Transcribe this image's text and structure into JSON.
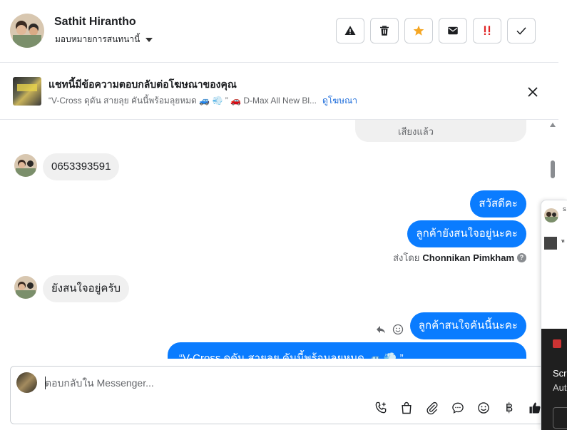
{
  "header": {
    "contact_name": "Sathit Hirantho",
    "assign_label": "มอบหมายการสนทนานี้",
    "actions": [
      {
        "name": "report-button",
        "icon": "warning-icon"
      },
      {
        "name": "delete-button",
        "icon": "trash-icon"
      },
      {
        "name": "star-button",
        "icon": "star-icon"
      },
      {
        "name": "mark-unread-button",
        "icon": "envelope-icon"
      },
      {
        "name": "priority-button",
        "icon": "double-exclamation-icon"
      },
      {
        "name": "mark-done-button",
        "icon": "check-icon"
      }
    ],
    "colors": {
      "star": "#f5a623",
      "priority": "#e02424"
    }
  },
  "ad_banner": {
    "title": "แชทนี้มีข้อความตอบกลับต่อโฆษณาของคุณ",
    "description": "“V-Cross ดุดัน สายลุย คันนี้พร้อมลุยหมด 🚙 💨 ” 🚗 D-Max All New Bl...",
    "link": "ดูโฆษณา"
  },
  "conversation": {
    "top_partial_text": "เสียงแล้ว",
    "messages": [
      {
        "direction": "in",
        "text": "0653393591"
      },
      {
        "direction": "out",
        "text": "สวัสดีคะ"
      },
      {
        "direction": "out",
        "text": "ลูกค้ายังสนใจอยู่นะคะ"
      },
      {
        "direction": "in",
        "text": "ยังสนใจอยู่ครับ"
      },
      {
        "direction": "out",
        "text": "ลูกค้าสนใจคันนี้นะคะ"
      },
      {
        "direction": "out",
        "text": "“V-Cross ดุดัน สายลุย คันนี้พร้อมลุยหมด 🚙 💨 ”"
      }
    ],
    "sent_by_prefix": "ส่งโดย",
    "sent_by_name": "Chonnikan Pimkham",
    "help_mark": "?"
  },
  "composer": {
    "placeholder": "ตอบกลับใน Messenger...",
    "value": "",
    "tools": [
      "add-call-icon",
      "shopping-bag-icon",
      "paperclip-icon",
      "chat-bubble-icon",
      "emoji-icon",
      "baht-icon",
      "thumbs-up-icon"
    ],
    "baht_symbol": "฿"
  },
  "side_panel": {
    "text_a": "S",
    "text_b": "พ",
    "dark_text_1": "Scre",
    "dark_text_2": "Aut"
  },
  "colors": {
    "outgoing_bubble": "#0a7cff",
    "incoming_bubble": "#f0f0f0",
    "link": "#216fdb"
  }
}
